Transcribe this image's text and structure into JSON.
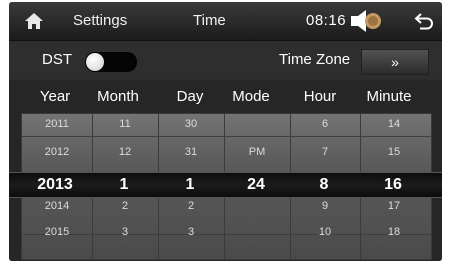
{
  "topbar": {
    "settings_label": "Settings",
    "time_label": "Time",
    "clock": "08:16"
  },
  "dst": {
    "label": "DST",
    "enabled": false
  },
  "timezone": {
    "label": "Time Zone",
    "button": "»"
  },
  "picker": {
    "headers": [
      "Year",
      "Month",
      "Day",
      "Mode",
      "Hour",
      "Minute"
    ],
    "rows": [
      [
        "2011",
        "11",
        "30",
        "",
        "6",
        "14"
      ],
      [
        "2012",
        "12",
        "31",
        "PM",
        "7",
        "15"
      ],
      [
        "2013",
        "1",
        "1",
        "24",
        "8",
        "16"
      ],
      [
        "2014",
        "2",
        "2",
        "",
        "9",
        "17"
      ],
      [
        "2015",
        "3",
        "3",
        "",
        "10",
        "18"
      ]
    ]
  },
  "icons": {
    "home": "home-icon",
    "volume": "volume-icon",
    "back": "back-icon"
  }
}
